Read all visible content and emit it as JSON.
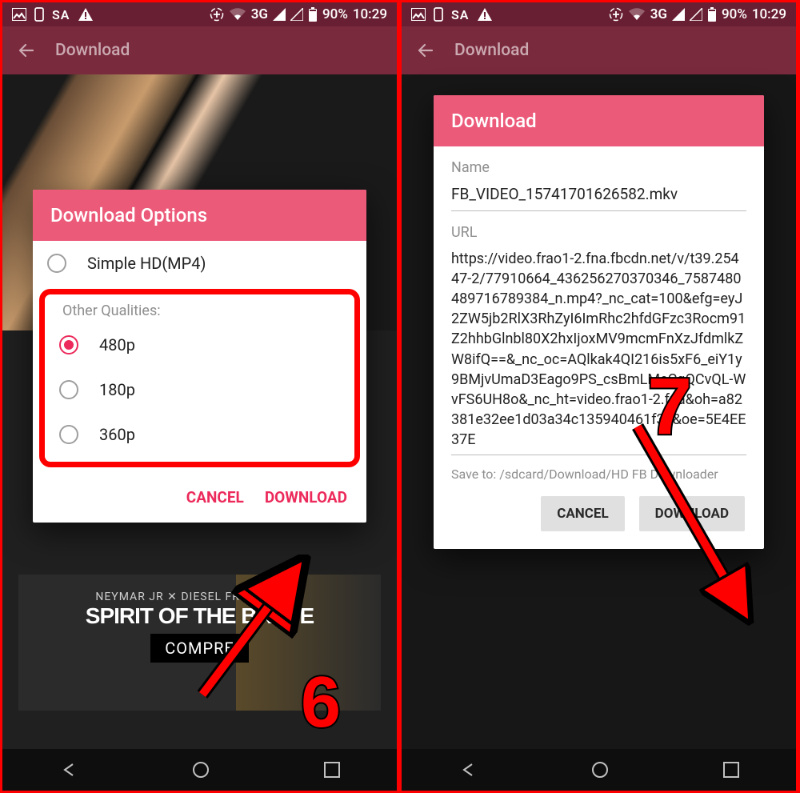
{
  "status": {
    "label": "SA",
    "network": "3G",
    "battery": "90%",
    "time": "10:29"
  },
  "header": {
    "title": "Download"
  },
  "bg_ad": {
    "line1": "NEYMAR JR ✕ DIESEL FRAGRANCES",
    "line2": "SPIRIT OF THE BRAVE",
    "button": "COMPRE"
  },
  "dialog_left": {
    "title": "Download Options",
    "option_simple": "Simple HD(MP4)",
    "group_label": "Other Qualities:",
    "options": [
      "480p",
      "180p",
      "360p"
    ],
    "cancel": "CANCEL",
    "download": "DOWNLOAD"
  },
  "dialog_right": {
    "title": "Download",
    "name_label": "Name",
    "name_value": "FB_VIDEO_15741701626582.mkv",
    "url_label": "URL",
    "url_value": "https://video.frao1-2.fna.fbcdn.net/v/t39.25447-2/77910664_436256270370346_7587480489716789384_n.mp4?_nc_cat=100&efg=eyJ2ZW5jb2RlX3RhZyI6ImRhc2hfdGFzc3Rocm91Z2hhbGlnbl80X2hxIjoxMV9mcmFnXzJfdmlkZW8ifQ==&_nc_oc=AQlkak4QI216is5xF6_eiY1y9BMjvUmaD3Eago9PS_csBmLMeCqQCvQL-WvFS6UH8o&_nc_ht=video.frao1-2.fna&oh=a82381e32ee1d03a34c135940461f38&oe=5E4EE37E",
    "save_to": "Save to: /sdcard/Download/HD FB Downloader",
    "cancel": "CANCEL",
    "download": "DOWNLOAD"
  },
  "annotation": {
    "six": "6",
    "seven": "7"
  }
}
